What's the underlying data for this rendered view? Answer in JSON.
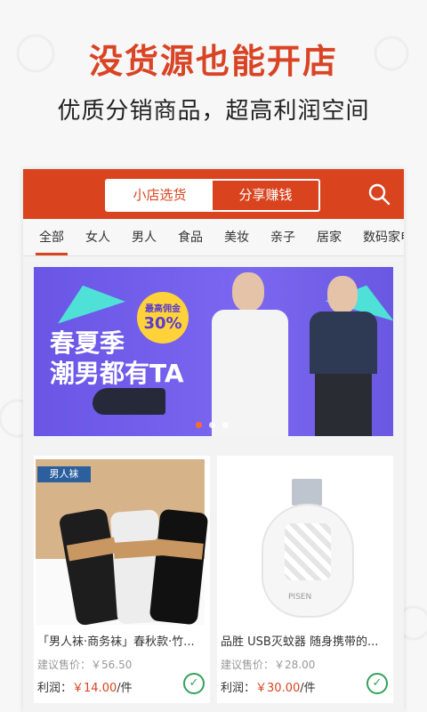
{
  "promo": {
    "title": "没货源也能开店",
    "subtitle": "优质分销商品，超高利润空间"
  },
  "toolbar": {
    "tabs": [
      "小店选货",
      "分享赚钱"
    ],
    "active_tab": "小店选货",
    "search_icon": "search-icon"
  },
  "categories": [
    "全部",
    "女人",
    "男人",
    "食品",
    "美妆",
    "亲子",
    "居家",
    "数码家电"
  ],
  "banner": {
    "badge_line1": "最高佣金",
    "badge_line2": "30%",
    "text1": "春夏季",
    "text2": "潮男都有TA",
    "active_dot": 0
  },
  "products": [
    {
      "title": "「男人袜·商务袜」春秋款·竹...",
      "image_tag": "男人袜",
      "suggested_price_label": "建议售价：",
      "suggested_price": "￥56.50",
      "profit_label": "利润：",
      "profit": "￥14.00",
      "profit_unit": "/件"
    },
    {
      "title": "品胜 USB灭蚊器 随身携带的...",
      "image_brand": "PISEN",
      "suggested_price_label": "建议售价：",
      "suggested_price": "￥28.00",
      "profit_label": "利润：",
      "profit": "￥30.00",
      "profit_unit": "/件"
    }
  ],
  "colors": {
    "accent": "#d9441f",
    "success": "#32a15a"
  }
}
